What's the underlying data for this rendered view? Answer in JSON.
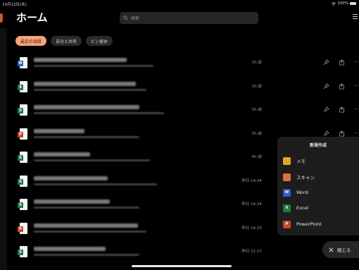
{
  "status": {
    "time": "10月12日(木)",
    "battery": "100%"
  },
  "header": {
    "title": "ホーム",
    "search_placeholder": "検索"
  },
  "filters": [
    {
      "label": "最近の項目",
      "active": true
    },
    {
      "label": "自分と共有",
      "active": false
    },
    {
      "label": "ピン留め",
      "active": false
    }
  ],
  "files": [
    {
      "type": "word",
      "tag": "W",
      "time": "1h 前"
    },
    {
      "type": "excel",
      "tag": "X",
      "time": "1h 前"
    },
    {
      "type": "excel",
      "tag": "X",
      "time": "5h 前"
    },
    {
      "type": "powerpoint",
      "tag": "P",
      "time": "5h 前"
    },
    {
      "type": "excel",
      "tag": "X",
      "time": "6h 前"
    },
    {
      "type": "excel",
      "tag": "X",
      "time": "昨日 14:34"
    },
    {
      "type": "excel",
      "tag": "X",
      "time": "昨日 14:34"
    },
    {
      "type": "powerpoint",
      "tag": "P",
      "time": "昨日 14:33"
    },
    {
      "type": "excel",
      "tag": "X",
      "time": "昨日 11:27"
    }
  ],
  "new_menu": {
    "title": "新規作成",
    "items": [
      {
        "label": "メモ",
        "icon": "note-icon",
        "color": "#e8a321",
        "glyph": ""
      },
      {
        "label": "スキャン",
        "icon": "camera-icon",
        "color": "#e07040",
        "glyph": ""
      },
      {
        "label": "Word",
        "icon": "word-icon",
        "color": "#2b5fc4",
        "glyph": "W"
      },
      {
        "label": "Excel",
        "icon": "excel-icon",
        "color": "#1f7a45",
        "glyph": "X"
      },
      {
        "label": "PowerPoint",
        "icon": "powerpoint-icon",
        "color": "#c9472b",
        "glyph": "P"
      }
    ]
  },
  "close_label": "閉じる",
  "colors": {
    "accent": "#f4a37a",
    "background": "#000000"
  }
}
